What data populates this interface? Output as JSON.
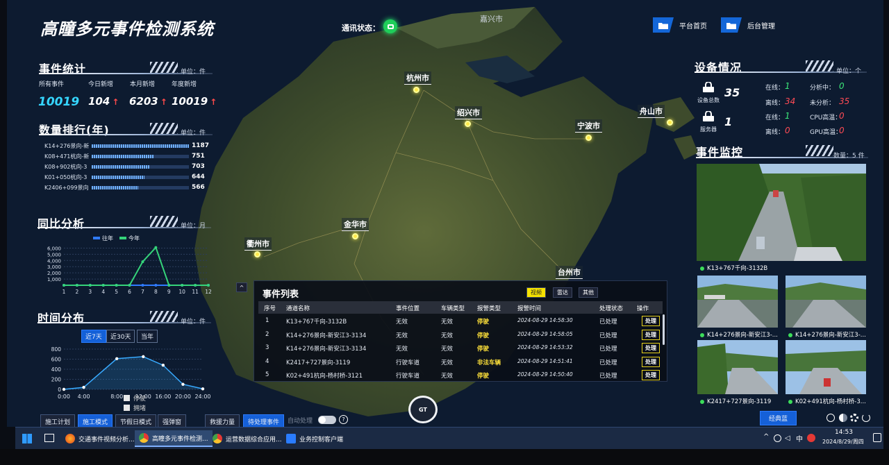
{
  "app": {
    "title": "高瞳多元事件检测系统",
    "comm_label": "通讯状态："
  },
  "nav": [
    {
      "label": "平台首页"
    },
    {
      "label": "后台管理"
    }
  ],
  "stats": {
    "title": "事件统计",
    "unit": "单位：件",
    "items": [
      {
        "label": "所有事件",
        "value": "10019",
        "up": false
      },
      {
        "label": "今日新增",
        "value": "104",
        "up": true
      },
      {
        "label": "本月新增",
        "value": "6203",
        "up": true
      },
      {
        "label": "年度新增",
        "value": "10019",
        "up": true
      }
    ],
    "arrow": "↑"
  },
  "ranking": {
    "title": "数量排行(年)",
    "unit": "单位：件",
    "rows": [
      {
        "name": "K14+276景向-新",
        "value": 1187
      },
      {
        "name": "K08+471杭向-新",
        "value": 751
      },
      {
        "name": "K08+902杭向-3",
        "value": 703
      },
      {
        "name": "K01+050杭向-3",
        "value": 644
      },
      {
        "name": "K2406+099景向",
        "value": 566
      }
    ],
    "max": 1187
  },
  "yoy": {
    "title": "同比分析",
    "unit": "单位：月"
  },
  "timedist": {
    "title": "时间分布",
    "unit": "单位：件",
    "tabs": [
      {
        "label": "近7天",
        "active": true
      },
      {
        "label": "近30天",
        "active": false
      },
      {
        "label": "当年",
        "active": false
      }
    ],
    "checks": [
      "停驶",
      "拥堵"
    ]
  },
  "chart_data": [
    {
      "type": "line",
      "title": "同比分析",
      "x": [
        "1",
        "2",
        "3",
        "4",
        "5",
        "6",
        "7",
        "8",
        "9",
        "10",
        "11",
        "12"
      ],
      "yticks": [
        "1,000",
        "2,000",
        "3,000",
        "4,000",
        "5,000",
        "6,000"
      ],
      "ylim": [
        0,
        6500
      ],
      "legend": "top",
      "series": [
        {
          "name": "往年",
          "color": "#2f7bff",
          "values": [
            0,
            0,
            0,
            0,
            0,
            0,
            0,
            0,
            0,
            0,
            0,
            0
          ]
        },
        {
          "name": "今年",
          "color": "#35d47a",
          "values": [
            0,
            0,
            0,
            0,
            0,
            0,
            3800,
            6100,
            0,
            0,
            0,
            0
          ]
        }
      ]
    },
    {
      "type": "area",
      "title": "时间分布",
      "x": [
        "0:00",
        "4:00",
        "8:00",
        "12:00",
        "16:00",
        "20:00",
        "24:00"
      ],
      "x_values": [
        0,
        3,
        8,
        12,
        15,
        18,
        21
      ],
      "yticks": [
        "0",
        "200",
        "400",
        "600",
        "800"
      ],
      "ylim": [
        0,
        800
      ],
      "series": [
        {
          "name": "",
          "color": "#38aaff",
          "points": [
            [
              0,
              0
            ],
            [
              3,
              40
            ],
            [
              8,
              610
            ],
            [
              12,
              650
            ],
            [
              15,
              480
            ],
            [
              18,
              100
            ],
            [
              21,
              10
            ]
          ]
        }
      ]
    }
  ],
  "devices": {
    "title": "设备情况",
    "unit": "单位：个",
    "total_label": "设备总数",
    "total_value": "35",
    "server_label": "服务器",
    "server_value": "1",
    "cam_stats": [
      {
        "label": "在线：",
        "value": "1",
        "color": "#3ce87a"
      },
      {
        "label": "分析中：",
        "value": "0",
        "color": "#3ce87a"
      },
      {
        "label": "离线：",
        "value": "34",
        "color": "#ff4b55"
      },
      {
        "label": "未分析：",
        "value": "35",
        "color": "#ff4b55"
      }
    ],
    "srv_stats": [
      {
        "label": "在线：",
        "value": "1",
        "color": "#3ce87a"
      },
      {
        "label": "CPU高温：",
        "value": "0",
        "color": "#ff4b55"
      },
      {
        "label": "离线：",
        "value": "0",
        "color": "#ff4b55"
      },
      {
        "label": "GPU高温：",
        "value": "0",
        "color": "#ff4b55"
      }
    ]
  },
  "monitor": {
    "title": "事件监控",
    "count": "数量：5 件",
    "cams": [
      {
        "caption": "K13+767千向-3132B"
      },
      {
        "caption": "K14+276景向-新安江3-..."
      },
      {
        "caption": "K14+276景向-新安江3-..."
      },
      {
        "caption": "K2417+727景向-3119"
      },
      {
        "caption": "K02+491杭向-杨村桥-3..."
      }
    ]
  },
  "cities": [
    {
      "name": "嘉兴市"
    },
    {
      "name": "杭州市"
    },
    {
      "name": "绍兴市"
    },
    {
      "name": "宁波市"
    },
    {
      "name": "舟山市"
    },
    {
      "name": "金华市"
    },
    {
      "name": "衢州市"
    },
    {
      "name": "台州市"
    }
  ],
  "events": {
    "title": "事件列表",
    "filters": [
      {
        "label": "视频",
        "on": true
      },
      {
        "label": "雷达",
        "on": false
      },
      {
        "label": "其他",
        "on": false
      }
    ],
    "columns": [
      "序号",
      "通道名称",
      "事件位置",
      "车辆类型",
      "报警类型",
      "报警时间",
      "处理状态",
      "操作"
    ],
    "rows": [
      [
        "1",
        "K13+767千向-3132B",
        "无效",
        "无效",
        "停驶",
        "2024-08-29 14:58:30",
        "已处理",
        "处理"
      ],
      [
        "2",
        "K14+276景向-新安江3-3134",
        "无效",
        "无效",
        "停驶",
        "2024-08-29 14:58:05",
        "已处理",
        "处理"
      ],
      [
        "3",
        "K14+276景向-新安江3-3134",
        "无效",
        "无效",
        "停驶",
        "2024-08-29 14:53:32",
        "已处理",
        "处理"
      ],
      [
        "4",
        "K2417+727景向-3119",
        "行驶车道",
        "无效",
        "非法车辆",
        "2024-08-29 14:51:41",
        "已处理",
        "处理"
      ],
      [
        "5",
        "K02+491杭向-杨村桥-3121",
        "行驶车道",
        "无效",
        "停驶",
        "2024-08-29 14:50:40",
        "已处理",
        "处理"
      ]
    ]
  },
  "bottom": {
    "buttons": [
      {
        "label": "施工计划",
        "active": false
      },
      {
        "label": "施工模式",
        "active": true
      },
      {
        "label": "节假日模式",
        "active": false
      },
      {
        "label": "强弹窗",
        "active": false
      },
      {
        "label": "救援力量",
        "active": false
      },
      {
        "label": "待处理事件",
        "active": true
      }
    ],
    "auto_label": "自动处理",
    "right_button": "经典蓝"
  },
  "taskbar": {
    "items": [
      {
        "label": "交通事件视频分析..."
      },
      {
        "label": "高瞳多元事件检测..."
      },
      {
        "label": "运营数据综合应用..."
      },
      {
        "label": "业务控制客户端"
      }
    ],
    "ime": "中",
    "time": "14:53",
    "date": "2024/8/29/周四"
  }
}
